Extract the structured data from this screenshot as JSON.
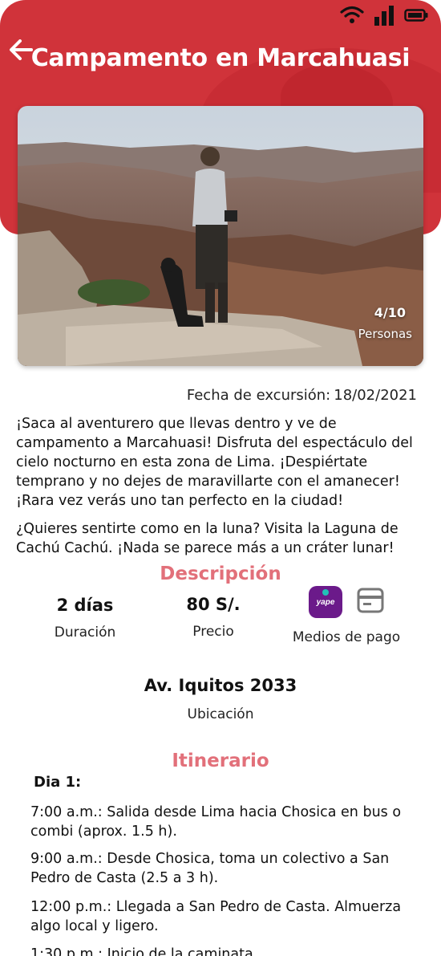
{
  "header": {
    "title": "Campamento en Marcahuasi",
    "back_icon": "arrow-left-icon",
    "background_color": "#d0333a"
  },
  "status_bar": {
    "icons": [
      "wifi-icon",
      "signal-icon",
      "battery-icon"
    ]
  },
  "hero": {
    "capacity_count": "4/10",
    "capacity_label": "Personas"
  },
  "trip": {
    "date_label": "Fecha de excursión:",
    "date_value": "18/02/2021",
    "paragraph1": "¡Saca al aventurero que llevas dentro y ve de campamento a Marcahuasi! Disfruta del espectáculo del cielo nocturno en esta zona de Lima. ¡Despiértate temprano y no dejes de maravillarte con el amanecer! ¡Rara vez verás uno tan perfecto en la ciudad!",
    "paragraph2": "¿Quieres sentirte como en la luna? Visita la Laguna de Cachú Cachú. ¡Nada se parece más a un cráter lunar!"
  },
  "description": {
    "title": "Descripción",
    "title_color": "#e2707a",
    "duration_value": "2 días",
    "duration_label": "Duración",
    "price_value": "80 S/.",
    "price_label": "Precio",
    "payment_label": "Medios de pago",
    "payment_icons": [
      "yape-icon",
      "card-icon"
    ],
    "yape_text": "yape"
  },
  "location": {
    "address": "Av. Iquitos 2033",
    "label": "Ubicación"
  },
  "itinerary": {
    "title": "Itinerario",
    "day_title": "Dia 1:",
    "items": [
      "7:00 a.m.: Salida desde Lima hacia Chosica en bus o combi (aprox. 1.5 h).",
      "9:00 a.m.: Desde Chosica, toma un colectivo a San Pedro de Casta (2.5 a 3 h).",
      "12:00 p.m.: Llegada a San Pedro de Casta. Almuerza algo local y ligero.",
      "1:30 p.m.: Inicio de la caminata"
    ]
  }
}
